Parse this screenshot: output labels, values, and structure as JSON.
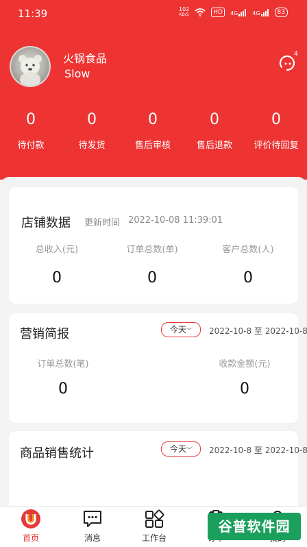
{
  "status_bar": {
    "time": "11:39",
    "net_speed_top": "102",
    "net_speed_bottom": "KB/S",
    "hd_label": "HD",
    "signal1": "4G",
    "signal2": "4G",
    "battery": "83"
  },
  "profile": {
    "shop_name": "火锅食品",
    "user_name": "Slow",
    "message_badge": "4"
  },
  "order_stats": [
    {
      "count": "0",
      "label": "待付款"
    },
    {
      "count": "0",
      "label": "待发货"
    },
    {
      "count": "0",
      "label": "售后审核"
    },
    {
      "count": "0",
      "label": "售后退款"
    },
    {
      "count": "0",
      "label": "评价待回复"
    }
  ],
  "store_data": {
    "title": "店铺数据",
    "update_label": "更新时间",
    "update_time": "2022-10-08 11:39:01",
    "metrics": [
      {
        "label": "总收入(元)",
        "value": "0"
      },
      {
        "label": "订单总数(单)",
        "value": "0"
      },
      {
        "label": "客户总数(人)",
        "value": "0"
      }
    ]
  },
  "marketing": {
    "title": "营销简报",
    "filter": "今天",
    "range": "2022-10-8 至 2022-10-8",
    "metrics": [
      {
        "label": "订单总数(笔)",
        "value": "0"
      },
      {
        "label": "收款金额(元)",
        "value": "0"
      }
    ]
  },
  "sales_stats": {
    "title": "商品销售统计",
    "filter": "今天",
    "range": "2022-10-8 至 2022-10-8"
  },
  "tabbar": [
    {
      "label": "首页",
      "icon": "home-logo-icon"
    },
    {
      "label": "消息",
      "icon": "message-icon"
    },
    {
      "label": "工作台",
      "icon": "workbench-icon"
    },
    {
      "label": "订单",
      "icon": "order-icon"
    },
    {
      "label": "我的",
      "icon": "profile-icon"
    }
  ],
  "watermark": "谷普软件园",
  "colors": {
    "brand_red": "#ee3333",
    "accent_red": "#e53b3b",
    "background": "#f3f3f3"
  }
}
